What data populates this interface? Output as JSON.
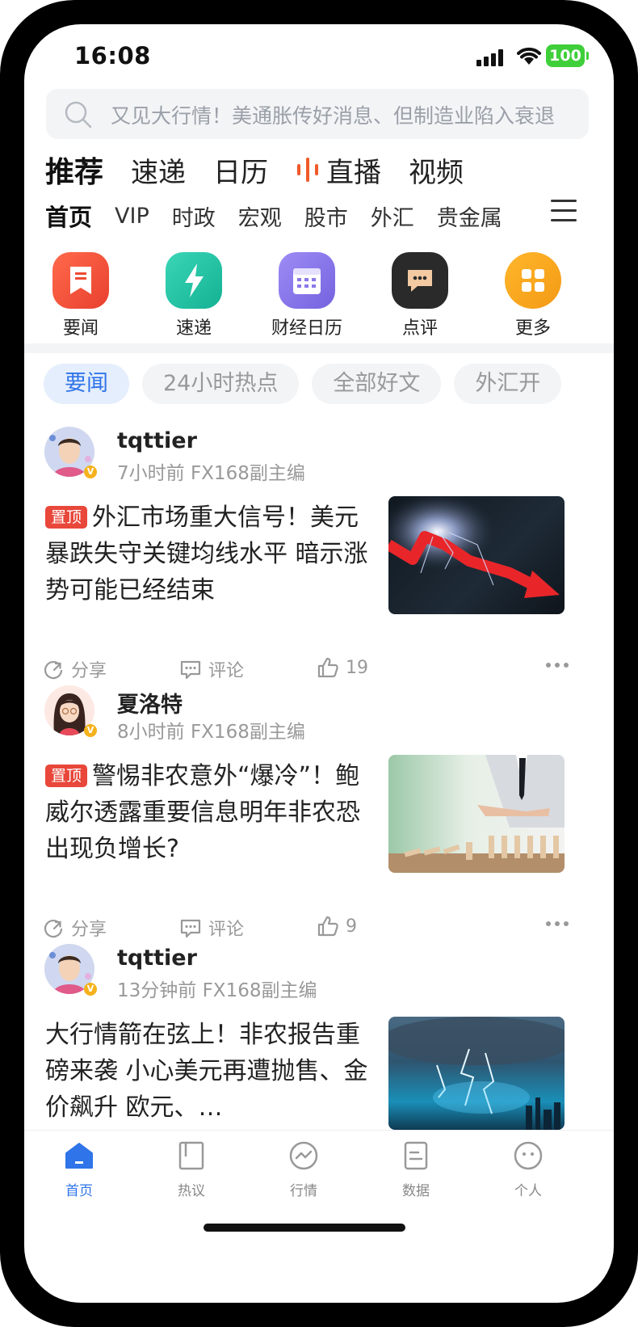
{
  "status_bar": {
    "time": "16:08",
    "battery": "100"
  },
  "search": {
    "placeholder": "又见大行情！美通胀传好消息、但制造业陷入衰退"
  },
  "top_tabs": [
    "推荐",
    "速递",
    "日历",
    "直播",
    "视频"
  ],
  "sub_tabs": [
    "首页",
    "VIP",
    "时政",
    "宏观",
    "股市",
    "外汇",
    "贵金属"
  ],
  "quick_links": [
    {
      "label": "要闻",
      "icon": "bookmark-news-icon",
      "color": "#f0543c"
    },
    {
      "label": "速递",
      "icon": "lightning-icon",
      "color": "#22c4a4"
    },
    {
      "label": "财经日历",
      "icon": "calendar-icon",
      "color": "#8a78e8"
    },
    {
      "label": "点评",
      "icon": "comment-bubble-icon",
      "color": "#2a2a2a"
    },
    {
      "label": "更多",
      "icon": "grid-icon",
      "color": "#f6a51c"
    }
  ],
  "filter_chips": [
    "要闻",
    "24小时热点",
    "全部好文",
    "外汇开"
  ],
  "posts": [
    {
      "author": "tqttier",
      "meta": "7小时前 FX168副主编",
      "pinned": true,
      "pin_label": "置顶",
      "title": "外汇市场重大信号！美元暴跌失守关键均线水平 暗示涨势可能已经结束",
      "share": "分享",
      "comment": "评论",
      "likes": "19"
    },
    {
      "author": "夏洛特",
      "meta": "8小时前 FX168副主编",
      "pinned": true,
      "pin_label": "置顶",
      "title": "警惕非农意外“爆冷”！鲍威尔透露重要信息明年非农恐出现负增长?",
      "share": "分享",
      "comment": "评论",
      "likes": "9"
    },
    {
      "author": "tqttier",
      "meta": "13分钟前 FX168副主编",
      "pinned": false,
      "title": "大行情箭在弦上！非农报告重磅来袭 小心美元再遭抛售、金价飙升 欧元、…"
    }
  ],
  "bottom_nav": [
    "首页",
    "热议",
    "行情",
    "数据",
    "个人"
  ],
  "colors": {
    "accent": "#2f74e8",
    "pin": "#e8473a"
  }
}
